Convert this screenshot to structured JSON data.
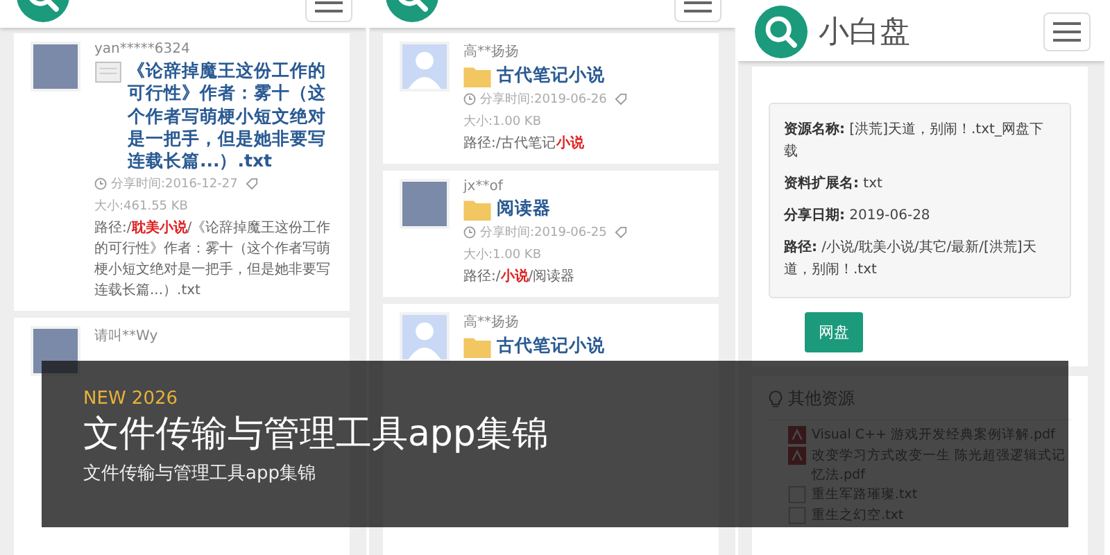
{
  "panels": [
    {
      "results": [
        {
          "user": "yan*****6324",
          "avatar": {
            "kind": "photo"
          },
          "kind": "file",
          "title": "《论辞掉魔王这份工作的可行性》作者：雾十（这个作者写萌梗小短文绝对是一把手，但是她非要写连载长篇...）.txt",
          "time": "分享时间:2016-12-27",
          "size": "大小:461.55 KB",
          "path": [
            {
              "text": "路径:/",
              "highlight": false
            },
            {
              "text": "耽美小说",
              "highlight": true
            },
            {
              "text": "/《论辞掉魔王这份工作的可行性》作者：雾十（这个作者写萌梗小短文绝对是一把手，但是她非要写连载长篇...）.txt",
              "highlight": false
            }
          ]
        },
        {
          "user": "请叫**Wy",
          "avatar": {
            "kind": "photo"
          }
        }
      ]
    },
    {
      "results": [
        {
          "user": "高**扬扬",
          "avatar": {
            "kind": "silhouette"
          },
          "kind": "folder",
          "title": "古代笔记小说",
          "time": "分享时间:2019-06-26",
          "size": "大小:1.00 KB",
          "path": [
            {
              "text": "路径:/古代笔记",
              "highlight": false
            },
            {
              "text": "小说",
              "highlight": true
            }
          ]
        },
        {
          "user": "jx**of",
          "avatar": {
            "kind": "photo"
          },
          "kind": "folder",
          "title": "阅读器",
          "time": "分享时间:2019-06-25",
          "size": "大小:1.00 KB",
          "path": [
            {
              "text": "路径:/",
              "highlight": false
            },
            {
              "text": "小说",
              "highlight": true
            },
            {
              "text": "/阅读器",
              "highlight": false
            }
          ]
        },
        {
          "user": "高**扬扬",
          "avatar": {
            "kind": "silhouette"
          },
          "kind": "folder",
          "title": "古代笔记小说"
        }
      ]
    },
    {
      "title": "小白盘",
      "detail": {
        "fields": [
          {
            "label": "资源名称:",
            "value": "[洪荒]天道，别闹！.txt_网盘下载"
          },
          {
            "label": "资料扩展名:",
            "value": "txt"
          },
          {
            "label": "分享日期:",
            "value": "2019-06-28"
          },
          {
            "label": "路径:",
            "value": "/小说/耽美小说/其它/最新/[洪荒]天道，别闹！.txt"
          }
        ],
        "button": "网盘",
        "other_title": "其他资源",
        "others": [
          {
            "kind": "pdf",
            "name": "Visual C++ 游戏开发经典案例详解.pdf"
          },
          {
            "kind": "pdf",
            "name": "改变学习方式改变一生 陈光超强逻辑式记忆法.pdf"
          },
          {
            "kind": "txt",
            "name": "重生军路璀璨.txt"
          },
          {
            "kind": "txt",
            "name": "重生之幻空.txt"
          }
        ]
      }
    }
  ],
  "caption": {
    "tag": "NEW 2026",
    "title": "文件传输与管理工具app集锦",
    "subtitle": "文件传输与管理工具app集锦"
  }
}
